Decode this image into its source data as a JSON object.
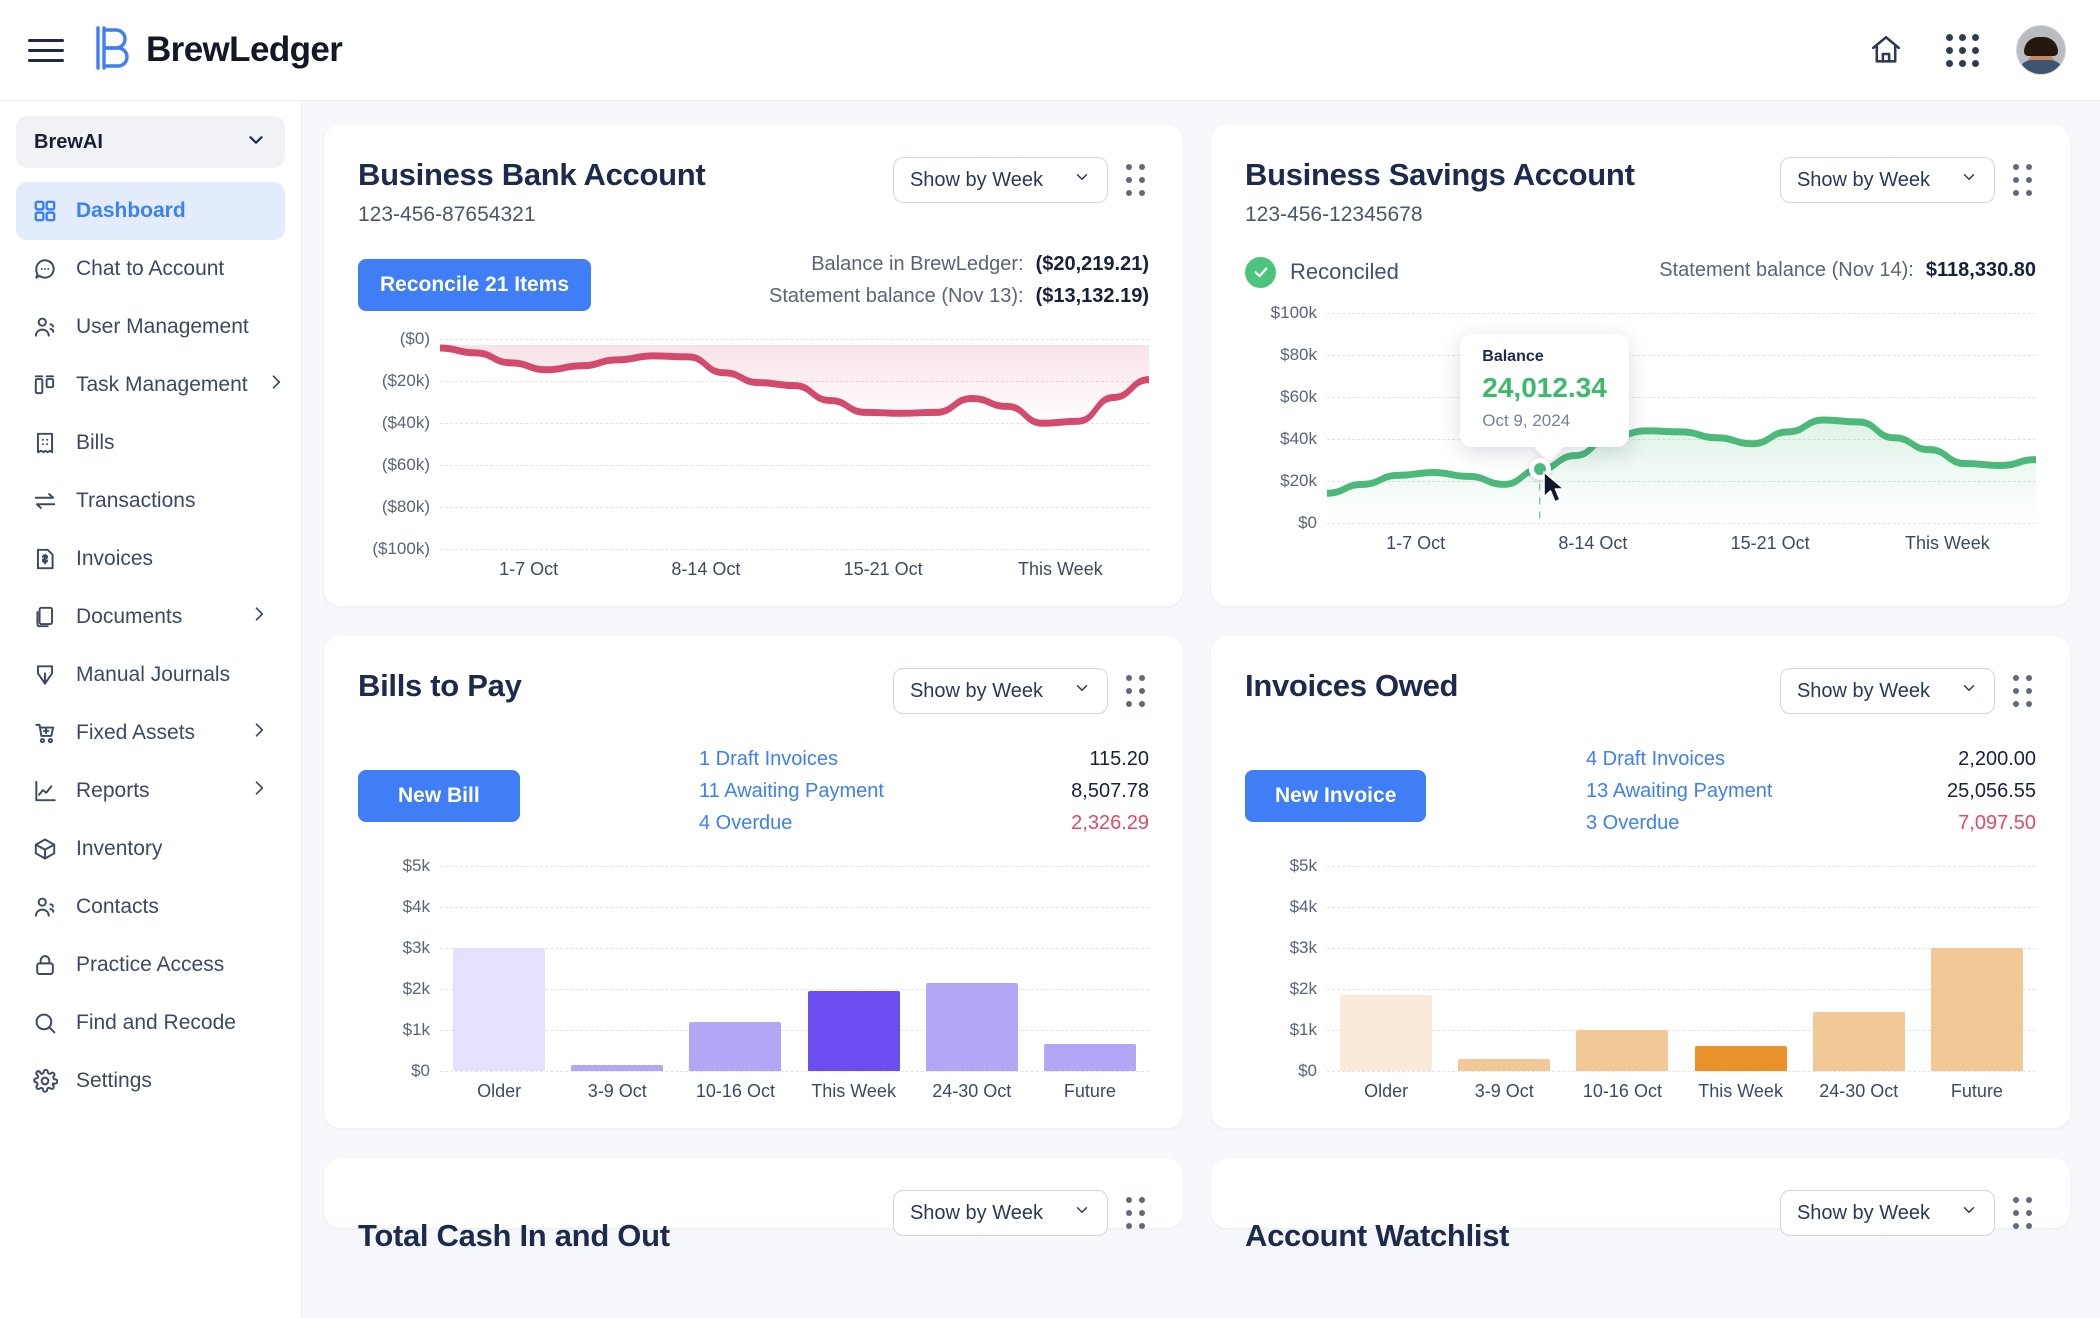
{
  "app": {
    "brand": "BrewLedger",
    "menu_icon": "hamburger-icon",
    "home_icon": "home-icon",
    "apps_icon": "apps-grid-icon",
    "avatar": "user-avatar"
  },
  "sidebar": {
    "org": {
      "name": "BrewAI",
      "chevron": "chevron-down-icon"
    },
    "items": [
      {
        "label": "Dashboard",
        "icon": "dashboard-grid-icon",
        "active": true,
        "expandable": false
      },
      {
        "label": "Chat to Account",
        "icon": "chat-bubble-icon",
        "active": false,
        "expandable": false
      },
      {
        "label": "User Management",
        "icon": "users-icon",
        "active": false,
        "expandable": false
      },
      {
        "label": "Task Management",
        "icon": "kanban-icon",
        "active": false,
        "expandable": true
      },
      {
        "label": "Bills",
        "icon": "receipt-icon",
        "active": false,
        "expandable": false
      },
      {
        "label": "Transactions",
        "icon": "transfer-arrows-icon",
        "active": false,
        "expandable": false
      },
      {
        "label": "Invoices",
        "icon": "invoice-dollar-icon",
        "active": false,
        "expandable": false
      },
      {
        "label": "Documents",
        "icon": "documents-icon",
        "active": false,
        "expandable": true
      },
      {
        "label": "Manual Journals",
        "icon": "journal-pen-icon",
        "active": false,
        "expandable": false
      },
      {
        "label": "Fixed Assets",
        "icon": "cart-plus-icon",
        "active": false,
        "expandable": true
      },
      {
        "label": "Reports",
        "icon": "line-chart-icon",
        "active": false,
        "expandable": true
      },
      {
        "label": "Inventory",
        "icon": "box-icon",
        "active": false,
        "expandable": false
      },
      {
        "label": "Contacts",
        "icon": "contacts-icon",
        "active": false,
        "expandable": false
      },
      {
        "label": "Practice Access",
        "icon": "lock-icon",
        "active": false,
        "expandable": false
      },
      {
        "label": "Find and Recode",
        "icon": "search-icon",
        "active": false,
        "expandable": false
      },
      {
        "label": "Settings",
        "icon": "gear-icon",
        "active": false,
        "expandable": false
      }
    ]
  },
  "colors": {
    "accent_blue": "#3f7ef4",
    "link_blue": "#3f7ef4",
    "negative_red": "#e24a64",
    "bank_line": "#d34a6c",
    "savings_line": "#4cb97a",
    "bills_bar": "#a99bf5",
    "bills_bar_highlight": "#6c4ef0",
    "invoices_bar": "#f0c184",
    "invoices_bar_highlight": "#e9922c"
  },
  "cards": {
    "bank": {
      "title": "Business Bank Account",
      "account_number": "123-456-87654321",
      "period_select": "Show by Week",
      "reconcile_button": "Reconcile 21 Items",
      "balance_label": "Balance in BrewLedger:",
      "balance_value": "($20,219.21)",
      "statement_label": "Statement balance (Nov 13):",
      "statement_value": "($13,132.19)"
    },
    "savings": {
      "title": "Business Savings Account",
      "account_number": "123-456-12345678",
      "period_select": "Show by Week",
      "status": "Reconciled",
      "status_icon": "check-circle-icon",
      "statement_label": "Statement balance (Nov 14):",
      "statement_value": "$118,330.80",
      "tooltip": {
        "title": "Balance",
        "value": "24,012.34",
        "date": "Oct 9, 2024"
      }
    },
    "bills": {
      "title": "Bills to Pay",
      "period_select": "Show by Week",
      "new_button": "New Bill",
      "rows": [
        {
          "label": "1 Draft Invoices",
          "amount": "115.20",
          "negative": false
        },
        {
          "label": "11 Awaiting Payment",
          "amount": "8,507.78",
          "negative": false
        },
        {
          "label": "4 Overdue",
          "amount": "2,326.29",
          "negative": true
        }
      ]
    },
    "invoices": {
      "title": "Invoices Owed",
      "period_select": "Show by Week",
      "new_button": "New Invoice",
      "rows": [
        {
          "label": "4 Draft Invoices",
          "amount": "2,200.00",
          "negative": false
        },
        {
          "label": "13 Awaiting Payment",
          "amount": "25,056.55",
          "negative": false
        },
        {
          "label": "3 Overdue",
          "amount": "7,097.50",
          "negative": true
        }
      ]
    },
    "cash": {
      "title": "Total Cash In and Out",
      "period_select": "Show by Week"
    },
    "watchlist": {
      "title": "Account Watchlist",
      "period_select": "Show by Week"
    }
  },
  "chart_data": [
    {
      "id": "bank-balance-chart",
      "type": "area",
      "title": "Business Bank Account",
      "xlabel": "",
      "ylabel": "",
      "grid": true,
      "legend": "none",
      "line_color": "#d34a6c",
      "ytick_labels": [
        "($0)",
        "($20k)",
        "($40k)",
        "($60k)",
        "($80k)",
        "($100k)"
      ],
      "yticks": [
        0,
        -20000,
        -40000,
        -60000,
        -80000,
        -100000
      ],
      "ylim": [
        -100000,
        0
      ],
      "tick_labels": [
        "1-7 Oct",
        "8-14 Oct",
        "15-21 Oct",
        "This Week"
      ],
      "x": [
        0,
        1,
        2,
        3,
        4,
        5,
        6,
        7,
        8,
        9,
        10,
        11,
        12,
        13,
        14,
        15,
        16,
        17,
        18,
        19,
        20
      ],
      "values": [
        -1500,
        -4000,
        -9000,
        -12500,
        -10500,
        -7500,
        -5500,
        -6000,
        -14000,
        -19000,
        -20500,
        -28000,
        -34000,
        -34500,
        -34000,
        -27000,
        -31000,
        -39500,
        -38500,
        -26500,
        -17500
      ]
    },
    {
      "id": "savings-balance-chart",
      "type": "area",
      "title": "Business Savings Account",
      "xlabel": "",
      "ylabel": "",
      "grid": true,
      "legend": "none",
      "line_color": "#4cb97a",
      "ytick_labels": [
        "$100k",
        "$80k",
        "$60k",
        "$40k",
        "$20k",
        "$0"
      ],
      "yticks": [
        100000,
        80000,
        60000,
        40000,
        20000,
        0
      ],
      "ylim": [
        0,
        100000
      ],
      "tick_labels": [
        "1-7 Oct",
        "8-14 Oct",
        "15-21 Oct",
        "This Week"
      ],
      "highlight": {
        "index": 6,
        "value": 24012.34,
        "label": "Oct 9, 2024"
      },
      "x": [
        0,
        1,
        2,
        3,
        4,
        5,
        6,
        7,
        8,
        9,
        10,
        11,
        12,
        13,
        14,
        15,
        16,
        17,
        18,
        19,
        20
      ],
      "values": [
        12000,
        16500,
        21000,
        22500,
        20500,
        16500,
        24012,
        31000,
        40000,
        43500,
        43000,
        40000,
        37000,
        43000,
        49000,
        48000,
        40000,
        34000,
        27000,
        26000,
        29000
      ]
    },
    {
      "id": "bills-to-pay-chart",
      "type": "bar",
      "title": "Bills to Pay",
      "xlabel": "",
      "ylabel": "",
      "grid": true,
      "legend": "none",
      "categories": [
        "Older",
        "3-9 Oct",
        "10-16 Oct",
        "This Week",
        "24-30 Oct",
        "Future"
      ],
      "values": [
        3000,
        150,
        1200,
        1950,
        2150,
        650
      ],
      "highlight_index": 3,
      "ytick_labels": [
        "$5k",
        "$4k",
        "$3k",
        "$2k",
        "$1k",
        "$0"
      ],
      "yticks": [
        5000,
        4000,
        3000,
        2000,
        1000,
        0
      ],
      "ylim": [
        0,
        5000
      ],
      "bar_colors": [
        "#e5e0fc",
        "#b4a6f7",
        "#b4a6f7",
        "#6c4ef0",
        "#b4a6f7",
        "#b4a6f7"
      ]
    },
    {
      "id": "invoices-owed-chart",
      "type": "bar",
      "title": "Invoices Owed",
      "xlabel": "",
      "ylabel": "",
      "grid": true,
      "legend": "none",
      "categories": [
        "Older",
        "3-9 Oct",
        "10-16 Oct",
        "This Week",
        "24-30 Oct",
        "Future"
      ],
      "values": [
        1850,
        300,
        1000,
        600,
        1450,
        3000
      ],
      "highlight_index": 3,
      "ytick_labels": [
        "$5k",
        "$4k",
        "$3k",
        "$2k",
        "$1k",
        "$0"
      ],
      "yticks": [
        5000,
        4000,
        3000,
        2000,
        1000,
        0
      ],
      "ylim": [
        0,
        5000
      ],
      "bar_colors": [
        "#fbeada",
        "#f2c896",
        "#f2c896",
        "#e9922c",
        "#f2c896",
        "#f2c896"
      ]
    }
  ]
}
